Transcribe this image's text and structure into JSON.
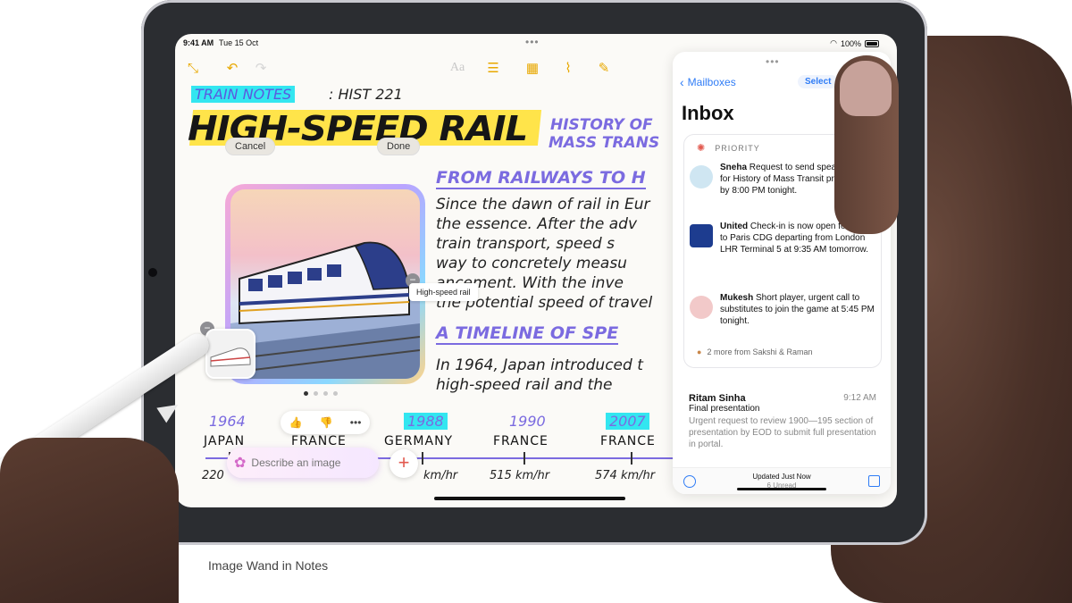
{
  "status_bar": {
    "time": "9:41 AM",
    "date": "Tue 15 Oct",
    "battery": "100%"
  },
  "notes": {
    "toolbar": {
      "text_format_label": "Aa"
    },
    "tag_label": "TRAIN NOTES",
    "course_label": ": HIST 221",
    "title": "HIGH-SPEED RAIL",
    "title_side": [
      "HISTORY OF",
      "MASS TRANS"
    ],
    "edit_buttons": {
      "cancel": "Cancel",
      "done": "Done"
    },
    "section1_heading": "FROM RAILWAYS TO H",
    "section1_lines": [
      "Since the dawn of rail in Eur",
      "the essence. After the adv",
      "train transport, speed s",
      "way to concretely measu",
      "ancement. With the inve",
      "the potential speed of travel"
    ],
    "image_label": "High-speed rail",
    "section2_heading": "A TIMELINE OF SPE",
    "section2_lines": [
      "In 1964, Japan introduced t",
      "high-speed rail and the"
    ],
    "timeline": [
      {
        "year": "1964",
        "country": "JAPAN",
        "speed": "220",
        "highlight": false
      },
      {
        "year": "",
        "country": "FRANCE",
        "speed": "",
        "highlight": false
      },
      {
        "year": "1988",
        "country": "GERMANY",
        "speed": "km/hr",
        "highlight": true
      },
      {
        "year": "1990",
        "country": "FRANCE",
        "speed": "515 km/hr",
        "highlight": false
      },
      {
        "year": "2007",
        "country": "FRANCE",
        "speed": "574 km/hr",
        "highlight": true
      }
    ],
    "image_wand": {
      "placeholder": "Describe an image"
    }
  },
  "mail": {
    "back_label": "Mailboxes",
    "select_label": "Select",
    "inbox_title": "Inbox",
    "priority_label": "PRIORITY",
    "priority_messages": [
      {
        "sender": "Sneha",
        "body": "Request to send speaker notes for History of Mass Transit presentation by 8:00 PM tonight."
      },
      {
        "sender": "United",
        "body": "Check-in is now open for flight to Paris CDG departing from London LHR Terminal 5 at 9:35 AM tomorrow."
      },
      {
        "sender": "Mukesh",
        "body": "Short player, urgent call to substitutes to join the game at 5:45 PM tonight."
      }
    ],
    "more_label": "2 more from Sakshi & Raman",
    "message": {
      "sender": "Ritam Sinha",
      "time": "9:12 AM",
      "subject": "Final presentation",
      "preview": "Urgent request to review 1900—195 section of presentation by EOD to submit full presentation in portal."
    },
    "footer": {
      "updated": "Updated Just Now",
      "unread": "6 Unread"
    }
  },
  "caption": "Image Wand in Notes",
  "colors": {
    "accent_yellow": "#e8a800",
    "highlight_cyan": "#33e6f0",
    "ink_purple": "#7b6be0",
    "mail_blue": "#2f7cf6"
  }
}
